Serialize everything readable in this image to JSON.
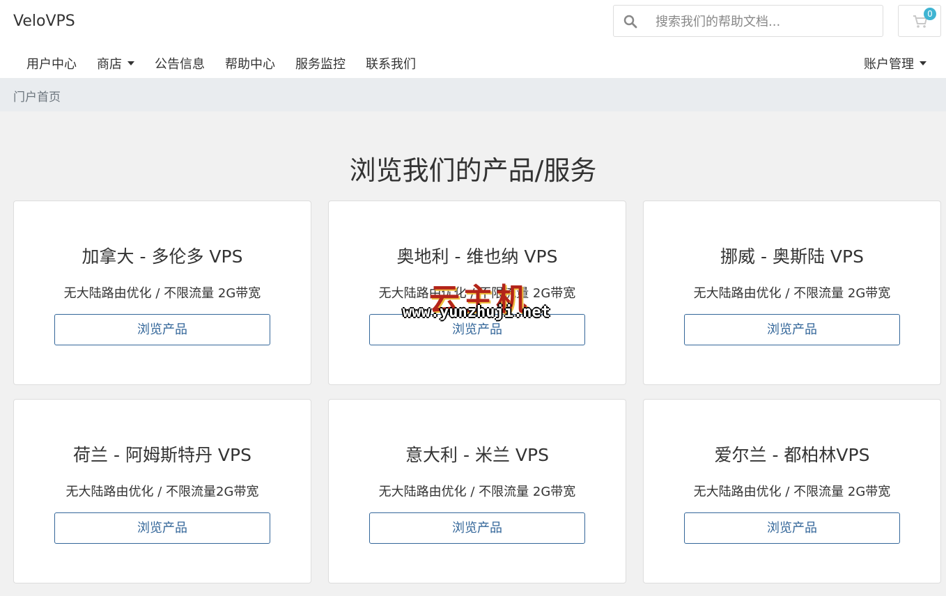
{
  "header": {
    "brand": "VeloVPS",
    "search_placeholder": "搜索我们的帮助文档...",
    "cart_count": "0",
    "icons": {
      "search": "search-icon",
      "cart": "cart-icon"
    }
  },
  "nav": {
    "items": [
      {
        "label": "用户中心"
      },
      {
        "label": "商店"
      },
      {
        "label": "公告信息"
      },
      {
        "label": "帮助中心"
      },
      {
        "label": "服务监控"
      },
      {
        "label": "联系我们"
      }
    ],
    "account": "账户管理"
  },
  "breadcrumb": {
    "current": "门户首页"
  },
  "main": {
    "heading": "浏览我们的产品/服务",
    "products": [
      {
        "title": "加拿大 - 多伦多 VPS",
        "desc": "无大陆路由优化 / 不限流量 2G带宽",
        "button": "浏览产品"
      },
      {
        "title": "奥地利 - 维也纳 VPS",
        "desc": "无大陆路由优化 / 不限流量 2G带宽",
        "button": "浏览产品"
      },
      {
        "title": "挪威 - 奥斯陆 VPS",
        "desc": "无大陆路由优化 / 不限流量 2G带宽",
        "button": "浏览产品"
      },
      {
        "title": "荷兰 - 阿姆斯特丹 VPS",
        "desc": "无大陆路由优化 / 不限流量2G带宽",
        "button": "浏览产品"
      },
      {
        "title": "意大利 - 米兰 VPS",
        "desc": "无大陆路由优化 / 不限流量 2G带宽",
        "button": "浏览产品"
      },
      {
        "title": "爱尔兰 - 都柏林VPS",
        "desc": "无大陆路由优化 / 不限流量 2G带宽",
        "button": "浏览产品"
      }
    ]
  },
  "watermark": {
    "cn": "云主机",
    "url": "www.yunzhuji.net"
  },
  "colors": {
    "link": "#336699",
    "badge": "#3fb4d2",
    "breadcrumb_bg": "#e9ecef",
    "page_bg": "#f1f1f1"
  }
}
